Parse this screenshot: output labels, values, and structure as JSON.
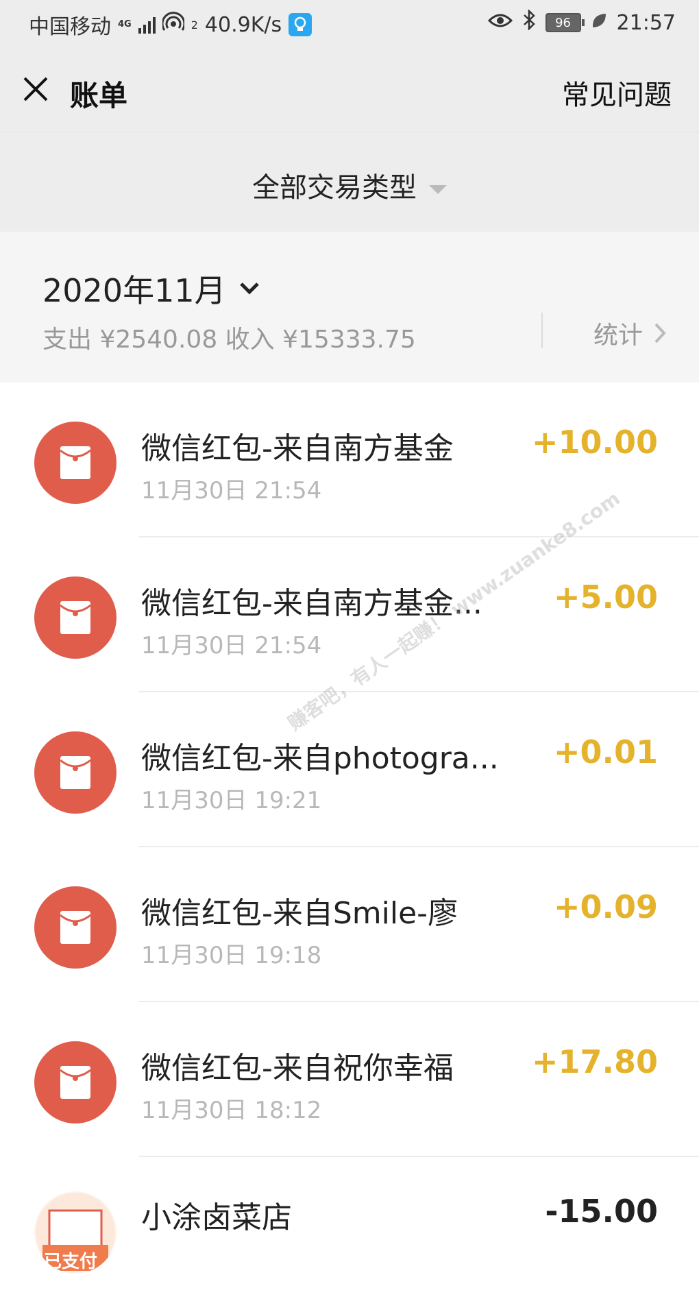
{
  "status_bar": {
    "carrier": "中国移动",
    "network_type": "4G",
    "hotspot_count": "2",
    "speed": "40.9K/s",
    "battery": "96",
    "time": "21:57"
  },
  "header": {
    "title": "账单",
    "faq_label": "常见问题"
  },
  "filter": {
    "label": "全部交易类型"
  },
  "month": {
    "label": "2020年11月",
    "summary": "支出 ¥2540.08 收入 ¥15333.75",
    "stats_label": "统计"
  },
  "colors": {
    "income": "#e5b32b",
    "expense": "#222222",
    "red_packet": "#e05d4b"
  },
  "transactions": [
    {
      "icon": "red-packet-icon",
      "title": "微信红包-来自南方基金",
      "time": "11月30日 21:54",
      "amount": "+10.00",
      "type": "income"
    },
    {
      "icon": "red-packet-icon",
      "title": "微信红包-来自南方基金...",
      "time": "11月30日 21:54",
      "amount": "+5.00",
      "type": "income"
    },
    {
      "icon": "red-packet-icon",
      "title": "微信红包-来自photogra...",
      "time": "11月30日 19:21",
      "amount": "+0.01",
      "type": "income"
    },
    {
      "icon": "red-packet-icon",
      "title": "微信红包-来自Smile-廖",
      "time": "11月30日 19:18",
      "amount": "+0.09",
      "type": "income"
    },
    {
      "icon": "red-packet-icon",
      "title": "微信红包-来自祝你幸福",
      "time": "11月30日 18:12",
      "amount": "+17.80",
      "type": "income"
    },
    {
      "icon": "paid-stamp-icon",
      "title": "小涂卤菜店",
      "time": "",
      "amount": "-15.00",
      "type": "expense",
      "stamp_text": "已支付"
    }
  ],
  "watermark": "赚客吧，有人一起赚！ www.zuanke8.com"
}
